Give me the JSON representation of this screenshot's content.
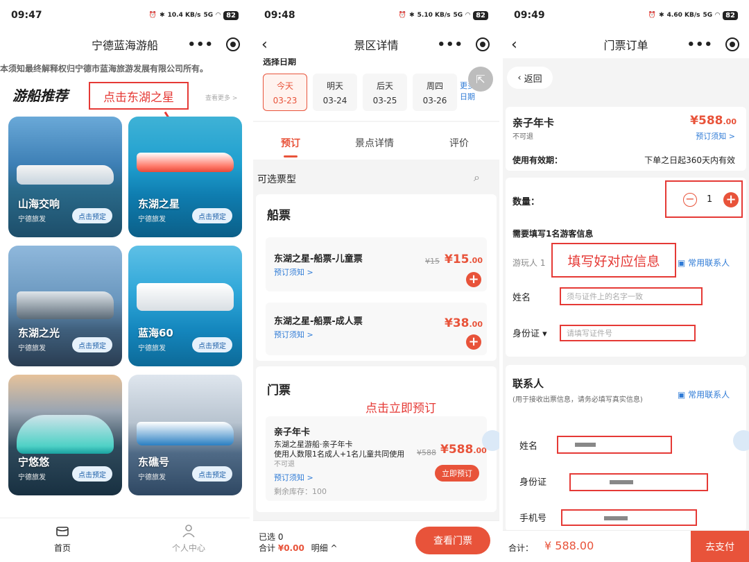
{
  "screens": [
    {
      "status": {
        "time": "09:47",
        "net_speed": "10.4 KB/s",
        "signal": "5G",
        "battery": "82"
      },
      "nav_title": "宁德蓝海游船",
      "notice": "本须知最终解释权归宁德市蓝海旅游发展有限公司所有。",
      "section_title": "游船推荐",
      "more": "查看更多 >",
      "annotation": "点击东湖之星",
      "cards": [
        {
          "name": "山海交响",
          "sub": "宁德旅发",
          "btn": "点击预定"
        },
        {
          "name": "东湖之星",
          "sub": "宁德旅发",
          "btn": "点击预定"
        },
        {
          "name": "东湖之光",
          "sub": "宁德旅发",
          "btn": "点击预定"
        },
        {
          "name": "蓝海60",
          "sub": "宁德旅发",
          "btn": "点击预定"
        },
        {
          "name": "宁悠悠",
          "sub": "宁德旅发",
          "btn": "点击预定"
        },
        {
          "name": "东礁号",
          "sub": "宁德旅发",
          "btn": "点击预定"
        }
      ],
      "tabs": [
        {
          "label": "首页",
          "active": true
        },
        {
          "label": "个人中心",
          "active": false
        }
      ]
    },
    {
      "status": {
        "time": "09:48",
        "net_speed": "5.10 KB/s",
        "signal": "5G",
        "battery": "82"
      },
      "nav_title": "景区详情",
      "date_header": "选择日期",
      "dates": [
        {
          "day": "今天",
          "date": "03-23",
          "selected": true
        },
        {
          "day": "明天",
          "date": "03-24",
          "selected": false
        },
        {
          "day": "后天",
          "date": "03-25",
          "selected": false
        },
        {
          "day": "周四",
          "date": "03-26",
          "selected": false
        }
      ],
      "more_dates": [
        "更多",
        "日期"
      ],
      "tabs": [
        "预订",
        "景点详情",
        "评价"
      ],
      "ticket_type_label": "可选票型",
      "boat_section": "船票",
      "boat_tickets": [
        {
          "name": "东湖之星-船票-儿童票",
          "notice": "预订须知 >",
          "old_price": "¥15",
          "price": "¥15",
          "price_dec": ".00"
        },
        {
          "name": "东湖之星-船票-成人票",
          "notice": "预订须知 >",
          "price": "¥38",
          "price_dec": ".00"
        }
      ],
      "gate_section": "门票",
      "annotation": "点击立即预订",
      "gate_ticket": {
        "name": "亲子年卡",
        "line1": "东湖之星游船·亲子年卡",
        "line2": "使用人数限1名成人+1名儿童共同使用",
        "old_price": "¥588",
        "price": "¥588",
        "price_dec": ".00",
        "refund": "不可退",
        "notice": "预订须知 >",
        "stock": "剩余库存：100",
        "button": "立即预订"
      },
      "bottom": {
        "selected_label": "已选",
        "selected_count": "0",
        "total_label": "合计",
        "total": "¥0.00",
        "detail": "明细 ^",
        "button": "查看门票"
      }
    },
    {
      "status": {
        "time": "09:49",
        "net_speed": "4.60 KB/s",
        "signal": "5G",
        "battery": "82"
      },
      "nav_title": "门票订单",
      "back": "返回",
      "product": {
        "name": "亲子年卡",
        "price": "¥588",
        "price_dec": ".00",
        "refund": "不可退",
        "notice": "预订须知 >",
        "validity_label": "使用有效期：",
        "validity": "下单之日起360天内有效"
      },
      "quantity_label": "数量：",
      "quantity": "1",
      "visitor_title": "需要填写1名游客信息",
      "visitor_label": "游玩人 1",
      "annotation": "填写好对应信息",
      "common_contacts": "常用联系人",
      "fields": [
        {
          "label": "姓名",
          "placeholder": "须与证件上的名字一致"
        },
        {
          "label": "身份证 ▾",
          "placeholder": "请填写证件号"
        }
      ],
      "contact_title": "联系人",
      "contact_note": "(用于接收出票信息，请务必填写真实信息)",
      "contact_fields": [
        "姓名",
        "身份证",
        "手机号"
      ],
      "bottom": {
        "total_label": "合计：",
        "total": "¥ 588.00",
        "button": "去支付"
      }
    }
  ],
  "colors": {
    "accent": "#e8533a",
    "annotation": "#e53935",
    "link": "#2f7bd6"
  }
}
